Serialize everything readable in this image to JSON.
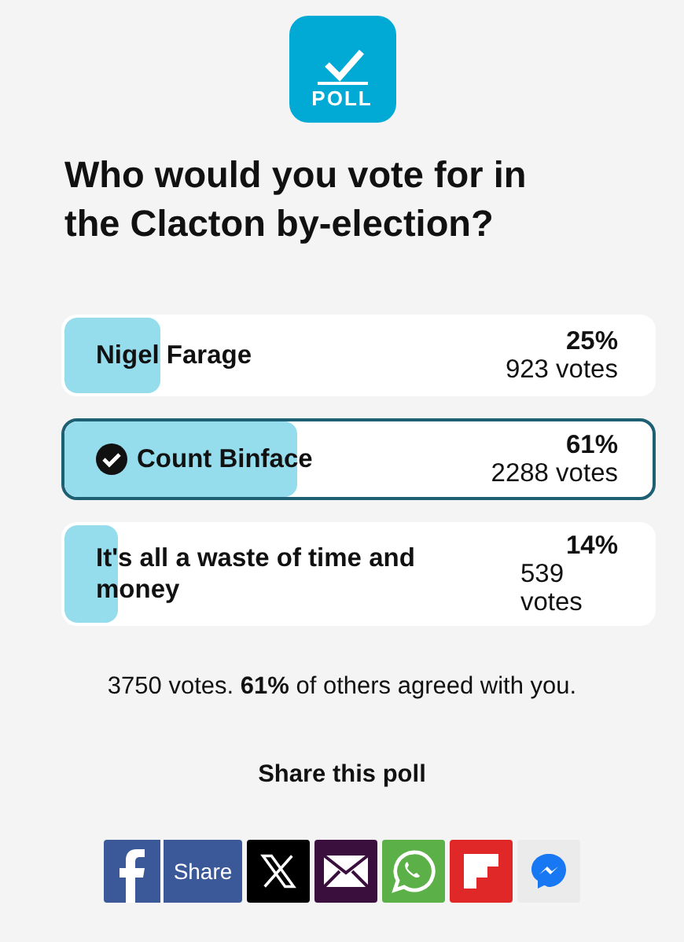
{
  "logo": {
    "label": "POLL"
  },
  "question": "Who would you vote for in the Clacton by-election?",
  "options": [
    {
      "label": "Nigel Farage",
      "percent": "25%",
      "votes": "923 votes",
      "selected": false
    },
    {
      "label": "Count Binface",
      "percent": "61%",
      "votes": "2288 votes",
      "selected": true
    },
    {
      "label": "It's all a waste of time and money",
      "percent": "14%",
      "votes": "539 votes",
      "selected": false
    }
  ],
  "summary": "3750 votes. **61%** of others agreed with you.",
  "share_title": "Share this poll",
  "share_buttons": [
    {
      "kind": "facebook",
      "label": "Share"
    },
    {
      "kind": "x"
    },
    {
      "kind": "email"
    },
    {
      "kind": "whatsapp"
    },
    {
      "kind": "flipboard"
    },
    {
      "kind": "messenger"
    }
  ]
}
